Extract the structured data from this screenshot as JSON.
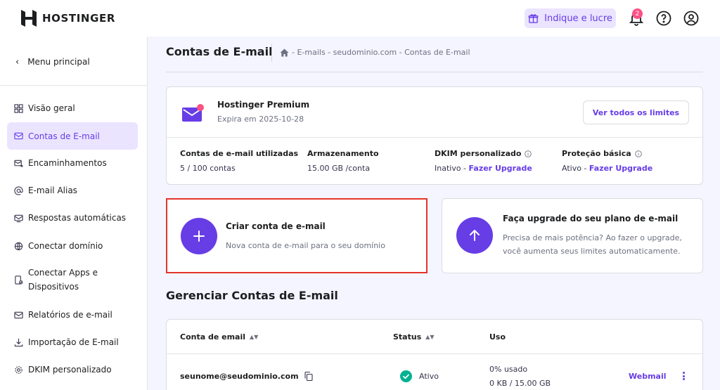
{
  "brand": {
    "name": "HOSTINGER"
  },
  "topbar": {
    "refer_label": "Indique e lucre",
    "notifications_count": "2"
  },
  "sidebar": {
    "main_menu_label": "Menu principal",
    "items": [
      {
        "label": "Visão geral",
        "icon": "grid-icon",
        "active": false
      },
      {
        "label": "Contas de E-mail",
        "icon": "mailbox-icon",
        "active": true
      },
      {
        "label": "Encaminhamentos",
        "icon": "mail-forward-icon",
        "active": false
      },
      {
        "label": "E-mail Alias",
        "icon": "at-icon",
        "active": false
      },
      {
        "label": "Respostas automáticas",
        "icon": "auto-reply-icon",
        "active": false
      },
      {
        "label": "Conectar domínio",
        "icon": "globe-icon",
        "active": false
      },
      {
        "label": "Conectar Apps e Dispositivos",
        "icon": "device-icon",
        "active": false
      },
      {
        "label": "Relatórios de e-mail",
        "icon": "mail-report-icon",
        "active": false
      },
      {
        "label": "Importação de E-mail",
        "icon": "download-icon",
        "active": false
      },
      {
        "label": "DKIM personalizado",
        "icon": "gear-icon",
        "active": false
      }
    ]
  },
  "header": {
    "title": "Contas de E-mail",
    "breadcrumb": "- E-mails - seudominio.com - Contas de E-mail"
  },
  "plan": {
    "name": "Hostinger Premium",
    "expires": "Expira em 2025-10-28",
    "limits_button": "Ver todos os limites",
    "stats": [
      {
        "label": "Contas de e-mail utilizadas",
        "value": "5 / 100 contas",
        "link": "",
        "info": false
      },
      {
        "label": "Armazenamento",
        "value": "15.00 GB /conta",
        "link": "",
        "info": false
      },
      {
        "label": "DKIM personalizado",
        "value": "Inativo - ",
        "link": "Fazer Upgrade",
        "info": true
      },
      {
        "label": "Proteção básica",
        "value": "Ativo - ",
        "link": "Fazer Upgrade",
        "info": true
      }
    ]
  },
  "create_card": {
    "title": "Criar conta de e-mail",
    "subtitle": "Nova conta de e-mail para o seu domínio"
  },
  "upgrade_card": {
    "title": "Faça upgrade do seu plano de e-mail",
    "line1": "Precisa de mais potência? Ao fazer o upgrade,",
    "line2": "você aumenta seus limites automaticamente."
  },
  "manage": {
    "title": "Gerenciar Contas de E-mail",
    "columns": {
      "email": "Conta de email",
      "status": "Status",
      "usage": "Uso"
    },
    "rows": [
      {
        "email": "seunome@seudominio.com",
        "status": "Ativo",
        "usage_pct": "0% usado",
        "usage_amount": "0 KB / 15.00 GB",
        "action": "Webmail"
      }
    ]
  },
  "colors": {
    "accent": "#673de6",
    "accent_light": "#ebe4ff",
    "highlight_border": "#e4342a",
    "success": "#00b090",
    "badge": "#fc5185"
  }
}
